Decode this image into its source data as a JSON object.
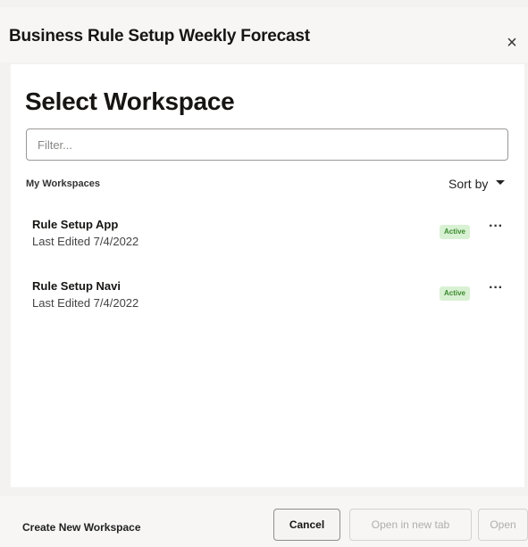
{
  "dialog": {
    "title": "Business Rule Setup Weekly Forecast",
    "close_glyph": "×"
  },
  "panel": {
    "heading": "Select Workspace",
    "filter_placeholder": "Filter...",
    "filter_value": "",
    "section_label": "My Workspaces",
    "sort_label": "Sort by"
  },
  "workspaces": [
    {
      "name": "Rule Setup App",
      "edited": "Last Edited 7/4/2022",
      "status": "Active",
      "more": "···"
    },
    {
      "name": "Rule Setup Navi",
      "edited": "Last Edited 7/4/2022",
      "status": "Active",
      "more": "···"
    }
  ],
  "footer": {
    "create_label": "Create New Workspace",
    "cancel_label": "Cancel",
    "open_new_tab_label": "Open in new tab",
    "open_label": "Open"
  },
  "colors": {
    "active_badge_bg": "#d9f1d3",
    "active_badge_text": "#3a8a2e",
    "dialog_bg": "#f3f2f1"
  },
  "icons": {
    "close": "close-icon",
    "sort": "caret-down-icon",
    "more": "more-actions-icon"
  }
}
